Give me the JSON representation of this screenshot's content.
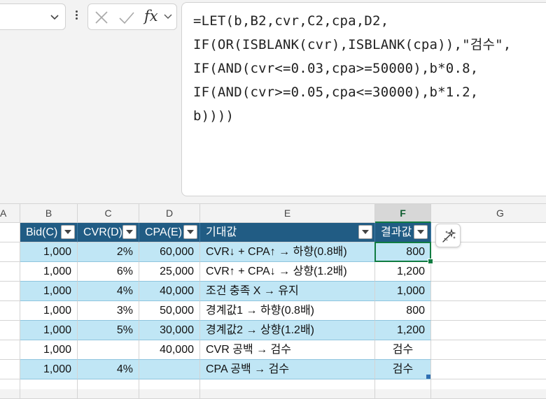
{
  "formula_bar": {
    "lines": [
      "=LET(b,B2,cvr,C2,cpa,D2,",
      "IF(OR(ISBLANK(cvr),ISBLANK(cpa)),\"검수\",",
      "IF(AND(cvr<=0.03,cpa>=50000),b*0.8,",
      "IF(AND(cvr>=0.05,cpa<=30000),b*1.2,",
      "b))))"
    ],
    "fx_label": "fx"
  },
  "columns": [
    "A",
    "B",
    "C",
    "D",
    "E",
    "F",
    "G"
  ],
  "table": {
    "headers": [
      "Bid(C)",
      "CVR(D)",
      "CPA(E)",
      "기대값",
      "결과값"
    ],
    "rows": [
      {
        "bid": "1,000",
        "cvr": "2%",
        "cpa": "60,000",
        "expect": "CVR↓ + CPA↑ → 하향(0.8배)",
        "result": "800"
      },
      {
        "bid": "1,000",
        "cvr": "6%",
        "cpa": "25,000",
        "expect": "CVR↑ + CPA↓ → 상향(1.2배)",
        "result": "1,200"
      },
      {
        "bid": "1,000",
        "cvr": "4%",
        "cpa": "40,000",
        "expect": "조건 충족 X → 유지",
        "result": "1,000"
      },
      {
        "bid": "1,000",
        "cvr": "3%",
        "cpa": "50,000",
        "expect": "경계값1 → 하향(0.8배)",
        "result": "800"
      },
      {
        "bid": "1,000",
        "cvr": "5%",
        "cpa": "30,000",
        "expect": "경계값2 → 상향(1.2배)",
        "result": "1,200"
      },
      {
        "bid": "1,000",
        "cvr": "",
        "cpa": "40,000",
        "expect": "CVR 공백 → 검수",
        "result": "검수"
      },
      {
        "bid": "1,000",
        "cvr": "4%",
        "cpa": "",
        "expect": "CPA 공백 → 검수",
        "result": "검수"
      }
    ]
  },
  "colors": {
    "header_fill": "#215c84",
    "band_fill": "#c0e6f5",
    "selection": "#107c41"
  }
}
